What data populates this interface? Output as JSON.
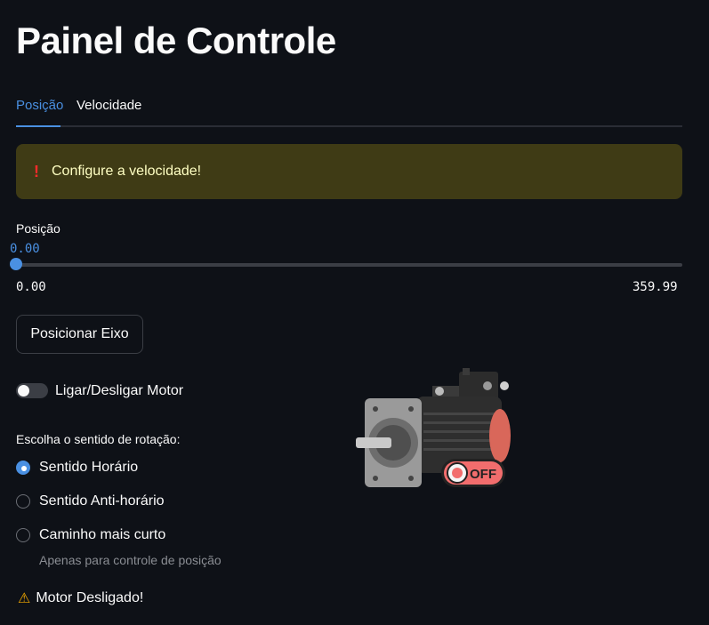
{
  "page": {
    "title": "Painel de Controle"
  },
  "tabs": [
    {
      "label": "Posição",
      "active": true
    },
    {
      "label": "Velocidade",
      "active": false
    }
  ],
  "alert": {
    "icon": "exclamation-icon",
    "text": "Configure a velocidade!"
  },
  "slider": {
    "label": "Posição",
    "value": "0.00",
    "min": "0.00",
    "max": "359.99",
    "fraction": 0
  },
  "button": {
    "label": "Posicionar Eixo"
  },
  "toggle": {
    "label": "Ligar/Desligar Motor",
    "on": false
  },
  "direction": {
    "label": "Escolha o sentido de rotação:",
    "options": [
      {
        "label": "Sentido Horário",
        "selected": true
      },
      {
        "label": "Sentido Anti-horário",
        "selected": false
      },
      {
        "label": "Caminho mais curto",
        "selected": false
      }
    ],
    "caption": "Apenas para controle de posição"
  },
  "motor_image": {
    "badge": "OFF"
  },
  "status": {
    "icon": "warning-icon",
    "text": "Motor Desligado!"
  },
  "colors": {
    "accent": "#4a90e2",
    "alert_bg": "#3f3b15",
    "warning": "#f2a900",
    "off_badge": "#f26d6d"
  }
}
